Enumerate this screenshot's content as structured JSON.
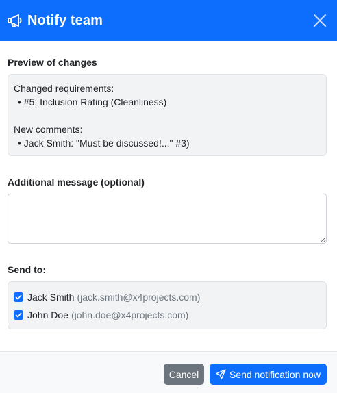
{
  "header": {
    "title": "Notify team",
    "icon": "megaphone-icon",
    "close_icon": "close-icon",
    "background": "#0d6efd"
  },
  "preview": {
    "label": "Preview of changes",
    "changed_heading": "Changed requirements:",
    "changed_items": [
      "• #5: Inclusion Rating (Cleanliness)"
    ],
    "comments_heading": "New comments:",
    "comment_items": [
      "• Jack Smith: \"Must be discussed!...\" #3)"
    ]
  },
  "message": {
    "label": "Additional message (optional)",
    "value": "",
    "placeholder": ""
  },
  "send_to": {
    "label": "Send to:",
    "recipients": [
      {
        "name": "Jack Smith",
        "email": "(jack.smith@x4projects.com)",
        "checked": true
      },
      {
        "name": "John Doe",
        "email": "(john.doe@x4projects.com)",
        "checked": true
      }
    ]
  },
  "footer": {
    "cancel_label": "Cancel",
    "send_label": "Send notification now",
    "send_icon": "paper-plane-icon"
  }
}
